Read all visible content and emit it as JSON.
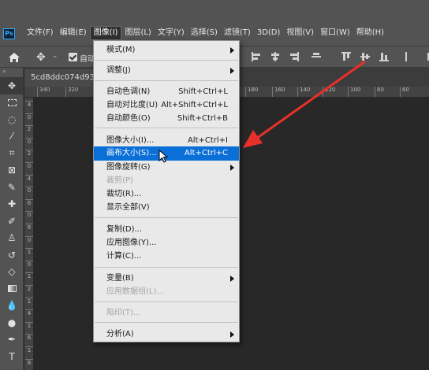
{
  "menubar": {
    "logo": "Ps",
    "items": [
      {
        "label": "文件(F)"
      },
      {
        "label": "编辑(E)"
      },
      {
        "label": "图像(I)",
        "active": true
      },
      {
        "label": "图层(L)"
      },
      {
        "label": "文字(Y)"
      },
      {
        "label": "选择(S)"
      },
      {
        "label": "滤镜(T)"
      },
      {
        "label": "3D(D)"
      },
      {
        "label": "视图(V)"
      },
      {
        "label": "窗口(W)"
      },
      {
        "label": "帮助(H)"
      }
    ]
  },
  "optbar": {
    "auto_label": "自动",
    "auto_checked": true
  },
  "document": {
    "tab_title": "5cd8ddc074d93.j"
  },
  "rulers": {
    "h_ticks": [
      "340",
      "320",
      "180",
      "160",
      "140",
      "120",
      "100",
      "80",
      "60"
    ],
    "v_ticks": [
      "4",
      "0",
      "2",
      "0",
      "2",
      "0",
      "4",
      "0",
      "6",
      "0",
      "8",
      "0",
      "1",
      "0",
      "1",
      "2",
      "1",
      "4",
      "1",
      "6",
      "1",
      "8"
    ]
  },
  "image_menu": {
    "items": [
      {
        "label": "模式(M)",
        "shortcut": "",
        "submenu": true
      },
      {
        "label": "调整(J)",
        "shortcut": "",
        "submenu": true
      },
      {
        "label": "自动色调(N)",
        "shortcut": "Shift+Ctrl+L"
      },
      {
        "label": "自动对比度(U)",
        "shortcut": "Alt+Shift+Ctrl+L"
      },
      {
        "label": "自动颜色(O)",
        "shortcut": "Shift+Ctrl+B"
      },
      {
        "label": "图像大小(I)...",
        "shortcut": "Alt+Ctrl+I"
      },
      {
        "label": "画布大小(S)...",
        "shortcut": "Alt+Ctrl+C",
        "highlighted": true
      },
      {
        "label": "图像旋转(G)",
        "shortcut": "",
        "submenu": true
      },
      {
        "label": "裁剪(P)",
        "shortcut": "",
        "disabled": true
      },
      {
        "label": "裁切(R)...",
        "shortcut": ""
      },
      {
        "label": "显示全部(V)",
        "shortcut": ""
      },
      {
        "label": "复制(D)...",
        "shortcut": ""
      },
      {
        "label": "应用图像(Y)...",
        "shortcut": ""
      },
      {
        "label": "计算(C)...",
        "shortcut": ""
      },
      {
        "label": "变量(B)",
        "shortcut": "",
        "submenu": true
      },
      {
        "label": "应用数据组(L)...",
        "shortcut": "",
        "disabled": true
      },
      {
        "label": "陷印(T)...",
        "shortcut": "",
        "disabled": true
      },
      {
        "label": "分析(A)",
        "shortcut": "",
        "submenu": true
      }
    ]
  },
  "colors": {
    "highlight": "#0a6fd6",
    "annotation_arrow": "#e8302a",
    "ui_gray": "#535353",
    "canvas": "#282828"
  }
}
